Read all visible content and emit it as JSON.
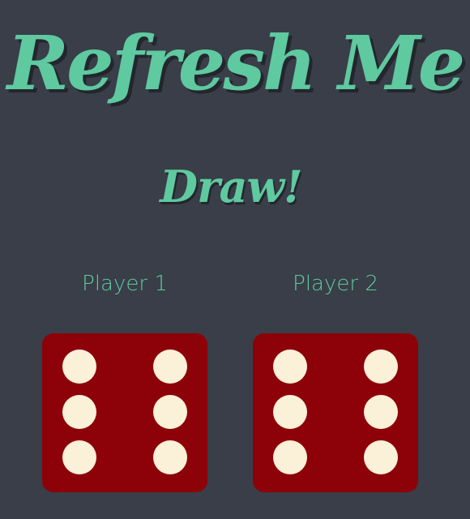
{
  "app": {
    "title": "Refresh Me",
    "result": "Draw!"
  },
  "players": [
    {
      "label": "Player 1",
      "die_value": 6
    },
    {
      "label": "Player 2",
      "die_value": 6
    }
  ],
  "colors": {
    "background": "#393e48",
    "accent": "#5fc9a0",
    "die": "#8d0208",
    "pip": "#fbf0d8"
  }
}
